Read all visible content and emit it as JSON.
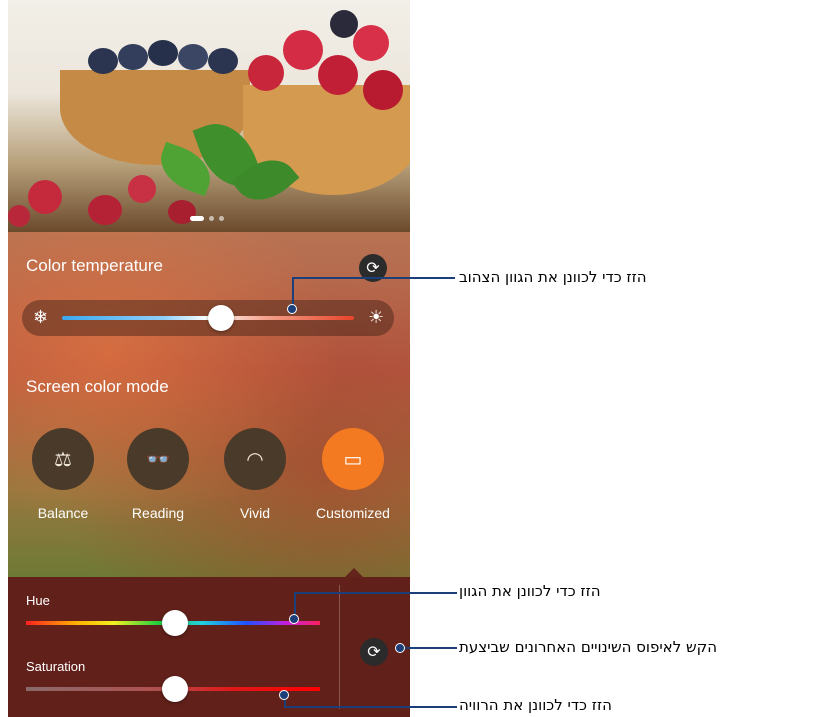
{
  "color_temperature": {
    "title": "Color temperature",
    "reset_icon": "refresh-icon",
    "cold_icon": "snowflake-icon",
    "warm_icon": "sun-icon",
    "level": 0.5
  },
  "screen_color_mode": {
    "title": "Screen color mode",
    "modes": [
      {
        "label": "Balance",
        "icon": "scale-icon",
        "glyph": "⚖",
        "active": false
      },
      {
        "label": "Reading",
        "icon": "glasses-icon",
        "glyph": "👓",
        "active": false
      },
      {
        "label": "Vivid",
        "icon": "rainbow-icon",
        "glyph": "◠",
        "active": false
      },
      {
        "label": "Customized",
        "icon": "customize-icon",
        "glyph": "▭",
        "active": true
      }
    ],
    "accent_color": "#f47a22"
  },
  "custom_panel": {
    "hue_label": "Hue",
    "saturation_label": "Saturation",
    "hue_level": 0.5,
    "saturation_level": 0.5,
    "reset_icon": "refresh-icon"
  },
  "callouts": {
    "temperature": "הזז כדי לכוונן את הגוון הצהוב",
    "hue": "הזז כדי לכוונן את הגוון",
    "reset": "הקש לאיפוס השינויים האחרונים שביצעת",
    "saturation": "הזז כדי לכוונן את הרוויה"
  },
  "callout_color": "#1c3f7a"
}
